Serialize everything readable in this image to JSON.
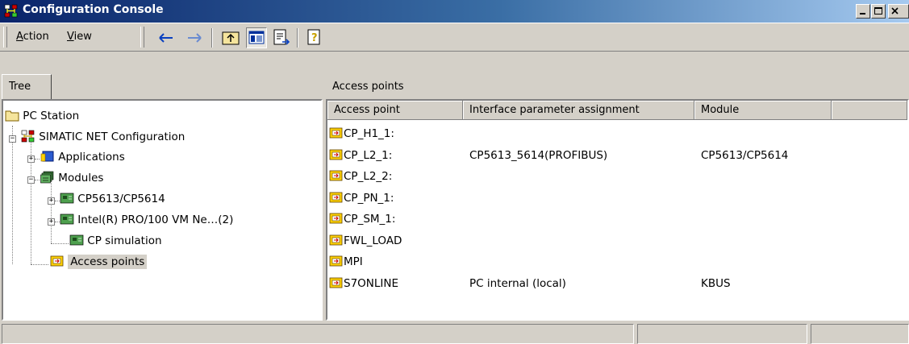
{
  "window": {
    "title": "Configuration Console",
    "buttons": [
      "minimize",
      "maximize",
      "close"
    ]
  },
  "menu": {
    "items": [
      {
        "label": "Action",
        "accel": "A"
      },
      {
        "label": "View",
        "accel": "V"
      }
    ]
  },
  "toolbar": {
    "icons": [
      "back-arrow-icon",
      "forward-arrow-icon",
      "up-folder-icon",
      "show-tree-icon",
      "export-list-icon",
      "help-icon"
    ]
  },
  "tree_tab": {
    "label": "Tree"
  },
  "tree": {
    "nodes": [
      {
        "label": "PC Station",
        "icon": "folder-icon",
        "expander": "",
        "level": 0
      },
      {
        "label": "SIMATIC NET Configuration",
        "icon": "network-config-icon",
        "expander": "−",
        "level": 0
      },
      {
        "label": "Applications",
        "icon": "applications-icon",
        "expander": "+",
        "level": 1
      },
      {
        "label": "Modules",
        "icon": "modules-icon",
        "expander": "−",
        "level": 1
      },
      {
        "label": "CP5613/CP5614",
        "icon": "module-card-icon",
        "expander": "+",
        "level": 2
      },
      {
        "label": "Intel(R) PRO/100 VM Ne…(2)",
        "icon": "module-card-icon",
        "expander": "+",
        "level": 2
      },
      {
        "label": "CP simulation",
        "icon": "module-card-icon",
        "expander": "",
        "level": 2
      },
      {
        "label": "Access points",
        "icon": "access-point-icon",
        "expander": "",
        "level": 1,
        "selected": true
      }
    ]
  },
  "list": {
    "header": "Access points",
    "columns": [
      "Access point",
      "Interface parameter assignment",
      "Module",
      ""
    ],
    "rows": [
      {
        "access_point": "CP_H1_1:",
        "assignment": "",
        "module": ""
      },
      {
        "access_point": "CP_L2_1:",
        "assignment": "CP5613_5614(PROFIBUS)",
        "module": "CP5613/CP5614"
      },
      {
        "access_point": "CP_L2_2:",
        "assignment": "",
        "module": ""
      },
      {
        "access_point": "CP_PN_1:",
        "assignment": "",
        "module": ""
      },
      {
        "access_point": "CP_SM_1:",
        "assignment": "",
        "module": ""
      },
      {
        "access_point": "FWL_LOAD",
        "assignment": "",
        "module": ""
      },
      {
        "access_point": "MPI",
        "assignment": "",
        "module": ""
      },
      {
        "access_point": "S7ONLINE",
        "assignment": "PC internal (local)",
        "module": "KBUS"
      }
    ]
  },
  "status_bar": {
    "panels": [
      "",
      "",
      ""
    ]
  },
  "colors": {
    "titlebar_start": "#0a246a",
    "titlebar_end": "#a6caf0",
    "face": "#d4d0c8",
    "selection": "#d4d0c8"
  }
}
